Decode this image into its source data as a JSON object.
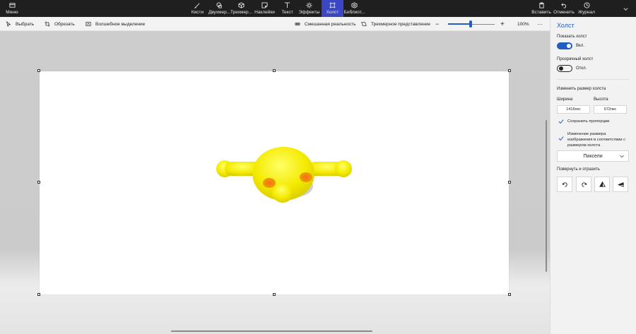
{
  "topbar": {
    "menu_label": "Меню",
    "tools": [
      {
        "label": "Кисти",
        "icon": "brush-icon"
      },
      {
        "label": "Двухмер...",
        "icon": "2d-shapes-icon"
      },
      {
        "label": "Трехмер...",
        "icon": "3d-shapes-icon"
      },
      {
        "label": "Наклейки",
        "icon": "stickers-icon"
      },
      {
        "label": "Текст",
        "icon": "text-icon"
      },
      {
        "label": "Эффекты",
        "icon": "effects-icon"
      },
      {
        "label": "Холст",
        "icon": "canvas-icon",
        "active": true
      },
      {
        "label": "Библиот...",
        "icon": "library-icon"
      }
    ],
    "paste_label": "Вставить",
    "undo_label": "Отменить",
    "history_label": "Журнал",
    "accent_color": "#3b46c4"
  },
  "subbar": {
    "select_label": "Выбрать",
    "crop_label": "Обрезать",
    "magic_select_label": "Волшебное выделение",
    "mixed_reality_label": "Смешанная реальность",
    "view_3d_label": "Трехмерное представление",
    "zoom_value": "100%",
    "zoom_minus": "−",
    "zoom_plus": "+",
    "more": "···"
  },
  "panel": {
    "title": "Холст",
    "show_canvas_label": "Показать холст",
    "show_canvas_state": "Вкл.",
    "transparent_canvas_label": "Прозрачный холст",
    "transparent_canvas_state": "Откл.",
    "resize_label": "Изменить размер холста",
    "width_label": "Ширина",
    "height_label": "Высота",
    "width_value": "1416пкс",
    "height_value": "672пкс",
    "keep_ratio_label": "Сохранить пропорции",
    "resize_image_label": "Изменение размера изображения в соответствии с размером холста",
    "units_value": "Пиксели",
    "rotate_label": "Повернуть и отразить",
    "accent_color": "#1f5fbf"
  }
}
